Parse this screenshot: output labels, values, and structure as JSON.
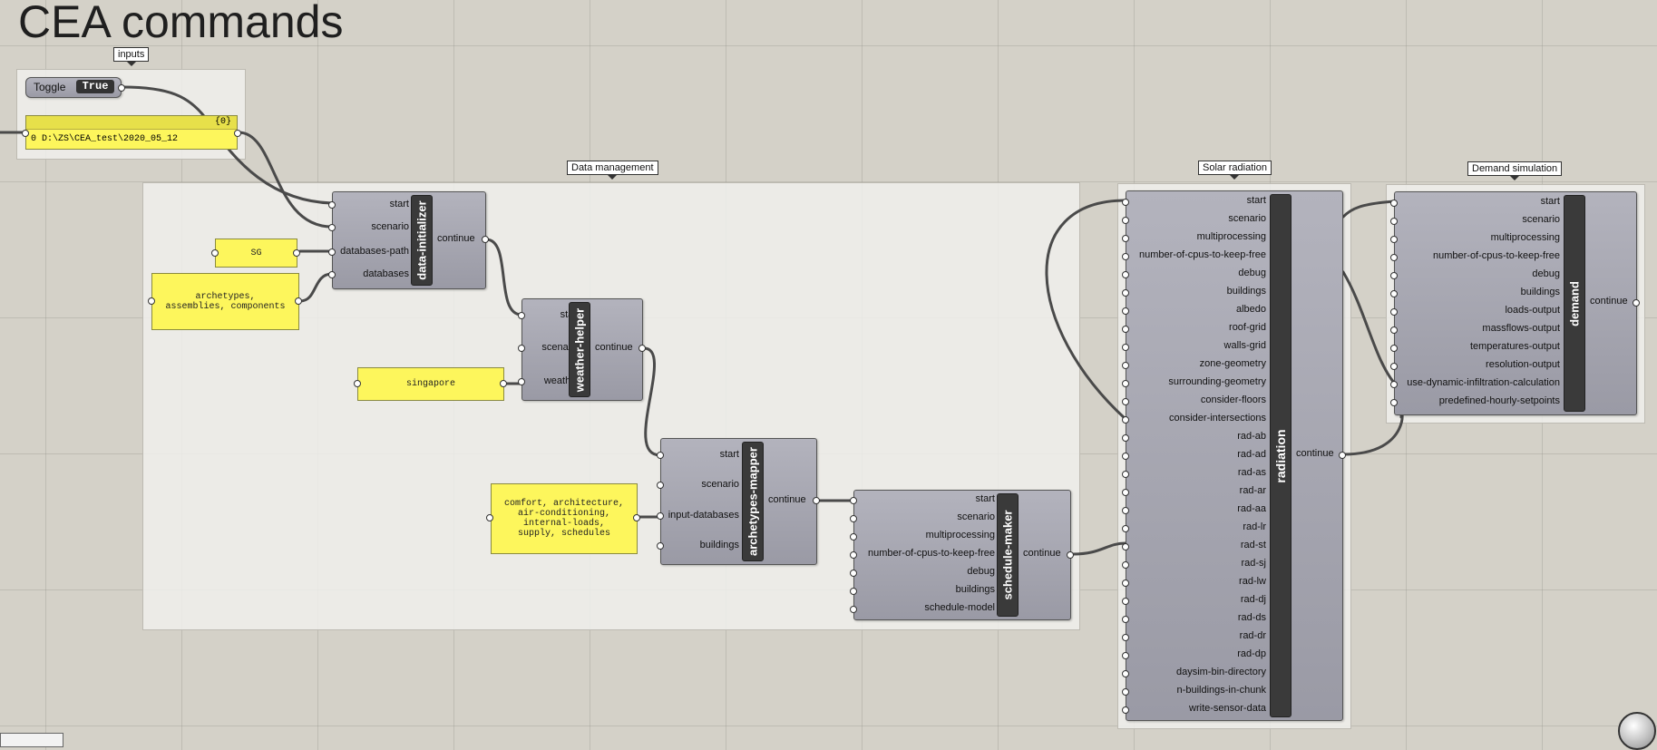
{
  "title": "CEA commands",
  "groups": {
    "inputs": "inputs",
    "data_management": "Data management",
    "solar_radiation": "Solar radiation",
    "demand_simulation": "Demand simulation"
  },
  "toggle": {
    "label": "Toggle",
    "value": "True"
  },
  "path_panel": {
    "index": "{0}",
    "value": "0 D:\\ZS\\CEA_test\\2020_05_12"
  },
  "panels": {
    "sg": "SG",
    "databases": "archetypes,\nassemblies, components",
    "weather": "singapore",
    "input_databases": "comfort, architecture,\nair-conditioning,\ninternal-loads,\nsupply, schedules"
  },
  "components": {
    "data_initializer": {
      "name": "data-initializer",
      "inputs": [
        "start",
        "scenario",
        "databases-path",
        "databases"
      ],
      "output": "continue"
    },
    "weather_helper": {
      "name": "weather-helper",
      "inputs": [
        "start",
        "scenario",
        "weather"
      ],
      "output": "continue"
    },
    "archetypes_mapper": {
      "name": "archetypes-mapper",
      "inputs": [
        "start",
        "scenario",
        "input-databases",
        "buildings"
      ],
      "output": "continue"
    },
    "schedule_maker": {
      "name": "schedule-maker",
      "inputs": [
        "start",
        "scenario",
        "multiprocessing",
        "number-of-cpus-to-keep-free",
        "debug",
        "buildings",
        "schedule-model"
      ],
      "output": "continue"
    },
    "radiation": {
      "name": "radiation",
      "inputs": [
        "start",
        "scenario",
        "multiprocessing",
        "number-of-cpus-to-keep-free",
        "debug",
        "buildings",
        "albedo",
        "roof-grid",
        "walls-grid",
        "zone-geometry",
        "surrounding-geometry",
        "consider-floors",
        "consider-intersections",
        "rad-ab",
        "rad-ad",
        "rad-as",
        "rad-ar",
        "rad-aa",
        "rad-lr",
        "rad-st",
        "rad-sj",
        "rad-lw",
        "rad-dj",
        "rad-ds",
        "rad-dr",
        "rad-dp",
        "daysim-bin-directory",
        "n-buildings-in-chunk",
        "write-sensor-data"
      ],
      "output": "continue"
    },
    "demand": {
      "name": "demand",
      "inputs": [
        "start",
        "scenario",
        "multiprocessing",
        "number-of-cpus-to-keep-free",
        "debug",
        "buildings",
        "loads-output",
        "massflows-output",
        "temperatures-output",
        "resolution-output",
        "use-dynamic-infiltration-calculation",
        "predefined-hourly-setpoints"
      ],
      "output": "continue"
    }
  },
  "colors": {
    "panel": "#fdf65c",
    "component": "#a5a5b0",
    "name_strip": "#3a3a3a",
    "canvas": "#d4d1c8"
  }
}
